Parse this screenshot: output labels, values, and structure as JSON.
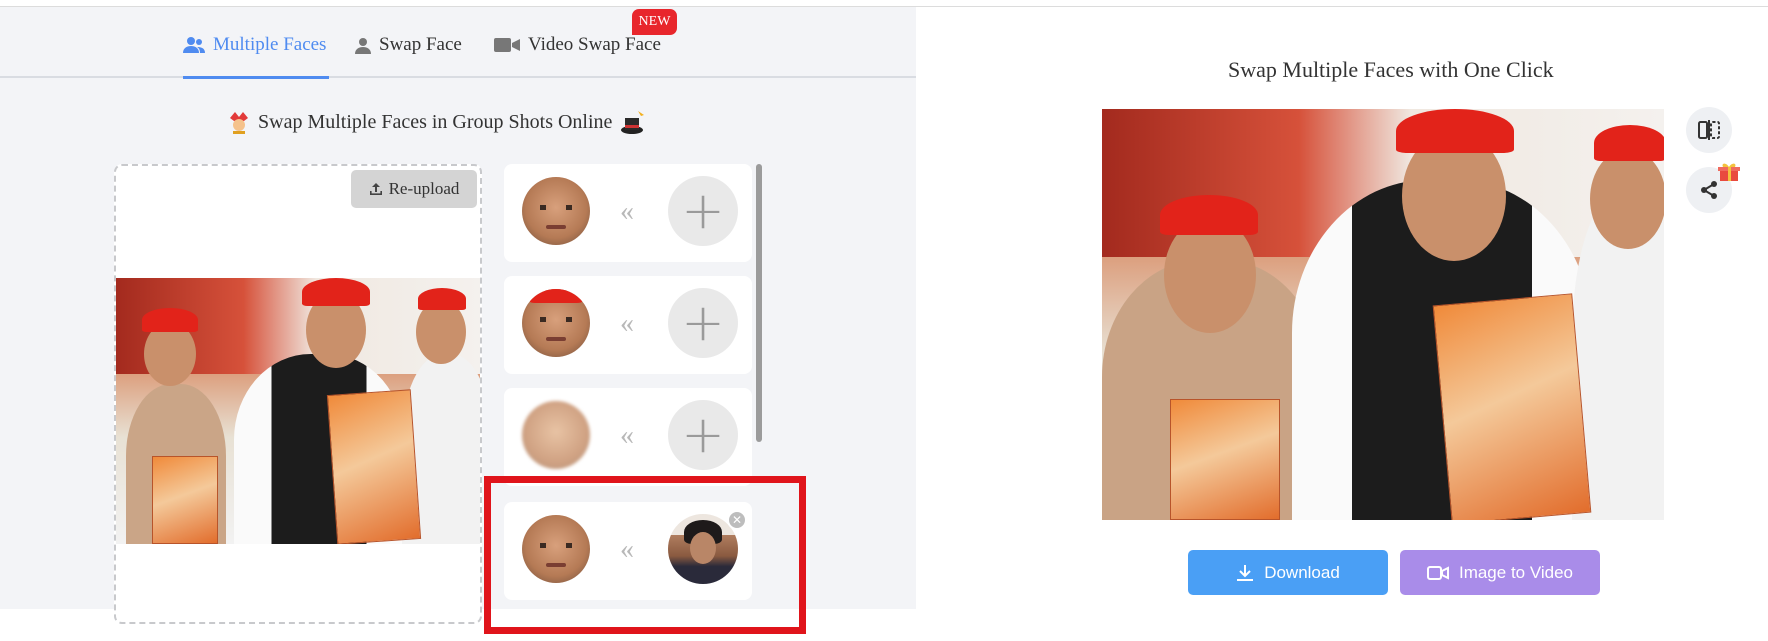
{
  "tabs": [
    {
      "label": "Multiple Faces",
      "icon": "users-icon",
      "active": true
    },
    {
      "label": "Swap Face",
      "icon": "user-icon",
      "active": false
    },
    {
      "label": "Video Swap Face",
      "icon": "video-camera-icon",
      "active": false,
      "badge": "NEW"
    }
  ],
  "left": {
    "heading": "Swap Multiple Faces in Group Shots Online",
    "heading_icons": [
      "jester-icon",
      "magic-hat-icon"
    ],
    "reupload_label": "Re-upload",
    "arrow_glyph": "«",
    "face_rows": [
      {
        "source": "face-1",
        "target": null
      },
      {
        "source": "face-2",
        "target": null
      },
      {
        "source": "face-3",
        "target": null
      },
      {
        "source": "face-4",
        "target": "uploaded-face"
      }
    ]
  },
  "right": {
    "title": "Swap Multiple Faces with One Click",
    "download_label": "Download",
    "image_to_video_label": "Image to Video",
    "side_buttons": [
      "compare-icon",
      "share-icon"
    ]
  },
  "colors": {
    "accent": "#4f8bf0",
    "download": "#4a9ff5",
    "image_to_video": "#a98ce9",
    "badge": "#e8262c",
    "highlight": "#e0141b"
  }
}
